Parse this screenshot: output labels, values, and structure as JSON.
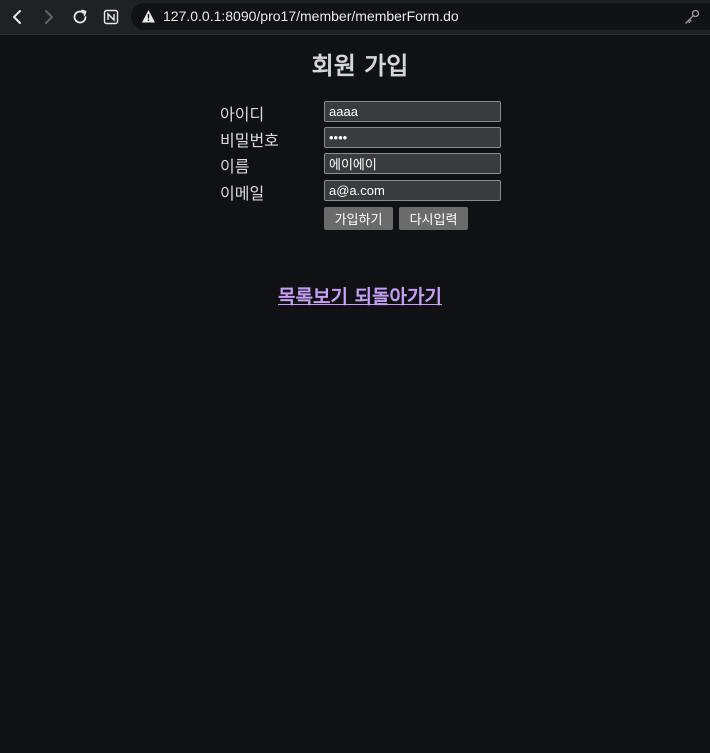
{
  "browser": {
    "url": "127.0.0.1:8090/pro17/member/memberForm.do",
    "back_icon": "back-arrow-icon",
    "forward_icon": "forward-arrow-icon",
    "reload_icon": "reload-icon",
    "extension_icon": "notion-icon",
    "security_icon": "warning-triangle-icon",
    "password_icon": "key-icon"
  },
  "page": {
    "title": "회원 가입",
    "fields": [
      {
        "label": "아이디",
        "value": "aaaa"
      },
      {
        "label": "비밀번호",
        "value": "aaaa"
      },
      {
        "label": "이름",
        "value": "에이에이"
      },
      {
        "label": "이메일",
        "value": "a@a.com"
      }
    ],
    "submit_label": "가입하기",
    "reset_label": "다시입력",
    "back_link": "목록보기 되돌아가기"
  },
  "colors": {
    "background": "#0f1114",
    "link": "#c69ff5",
    "button": "#6b6b6b",
    "input_bg": "#3a3b3e"
  }
}
